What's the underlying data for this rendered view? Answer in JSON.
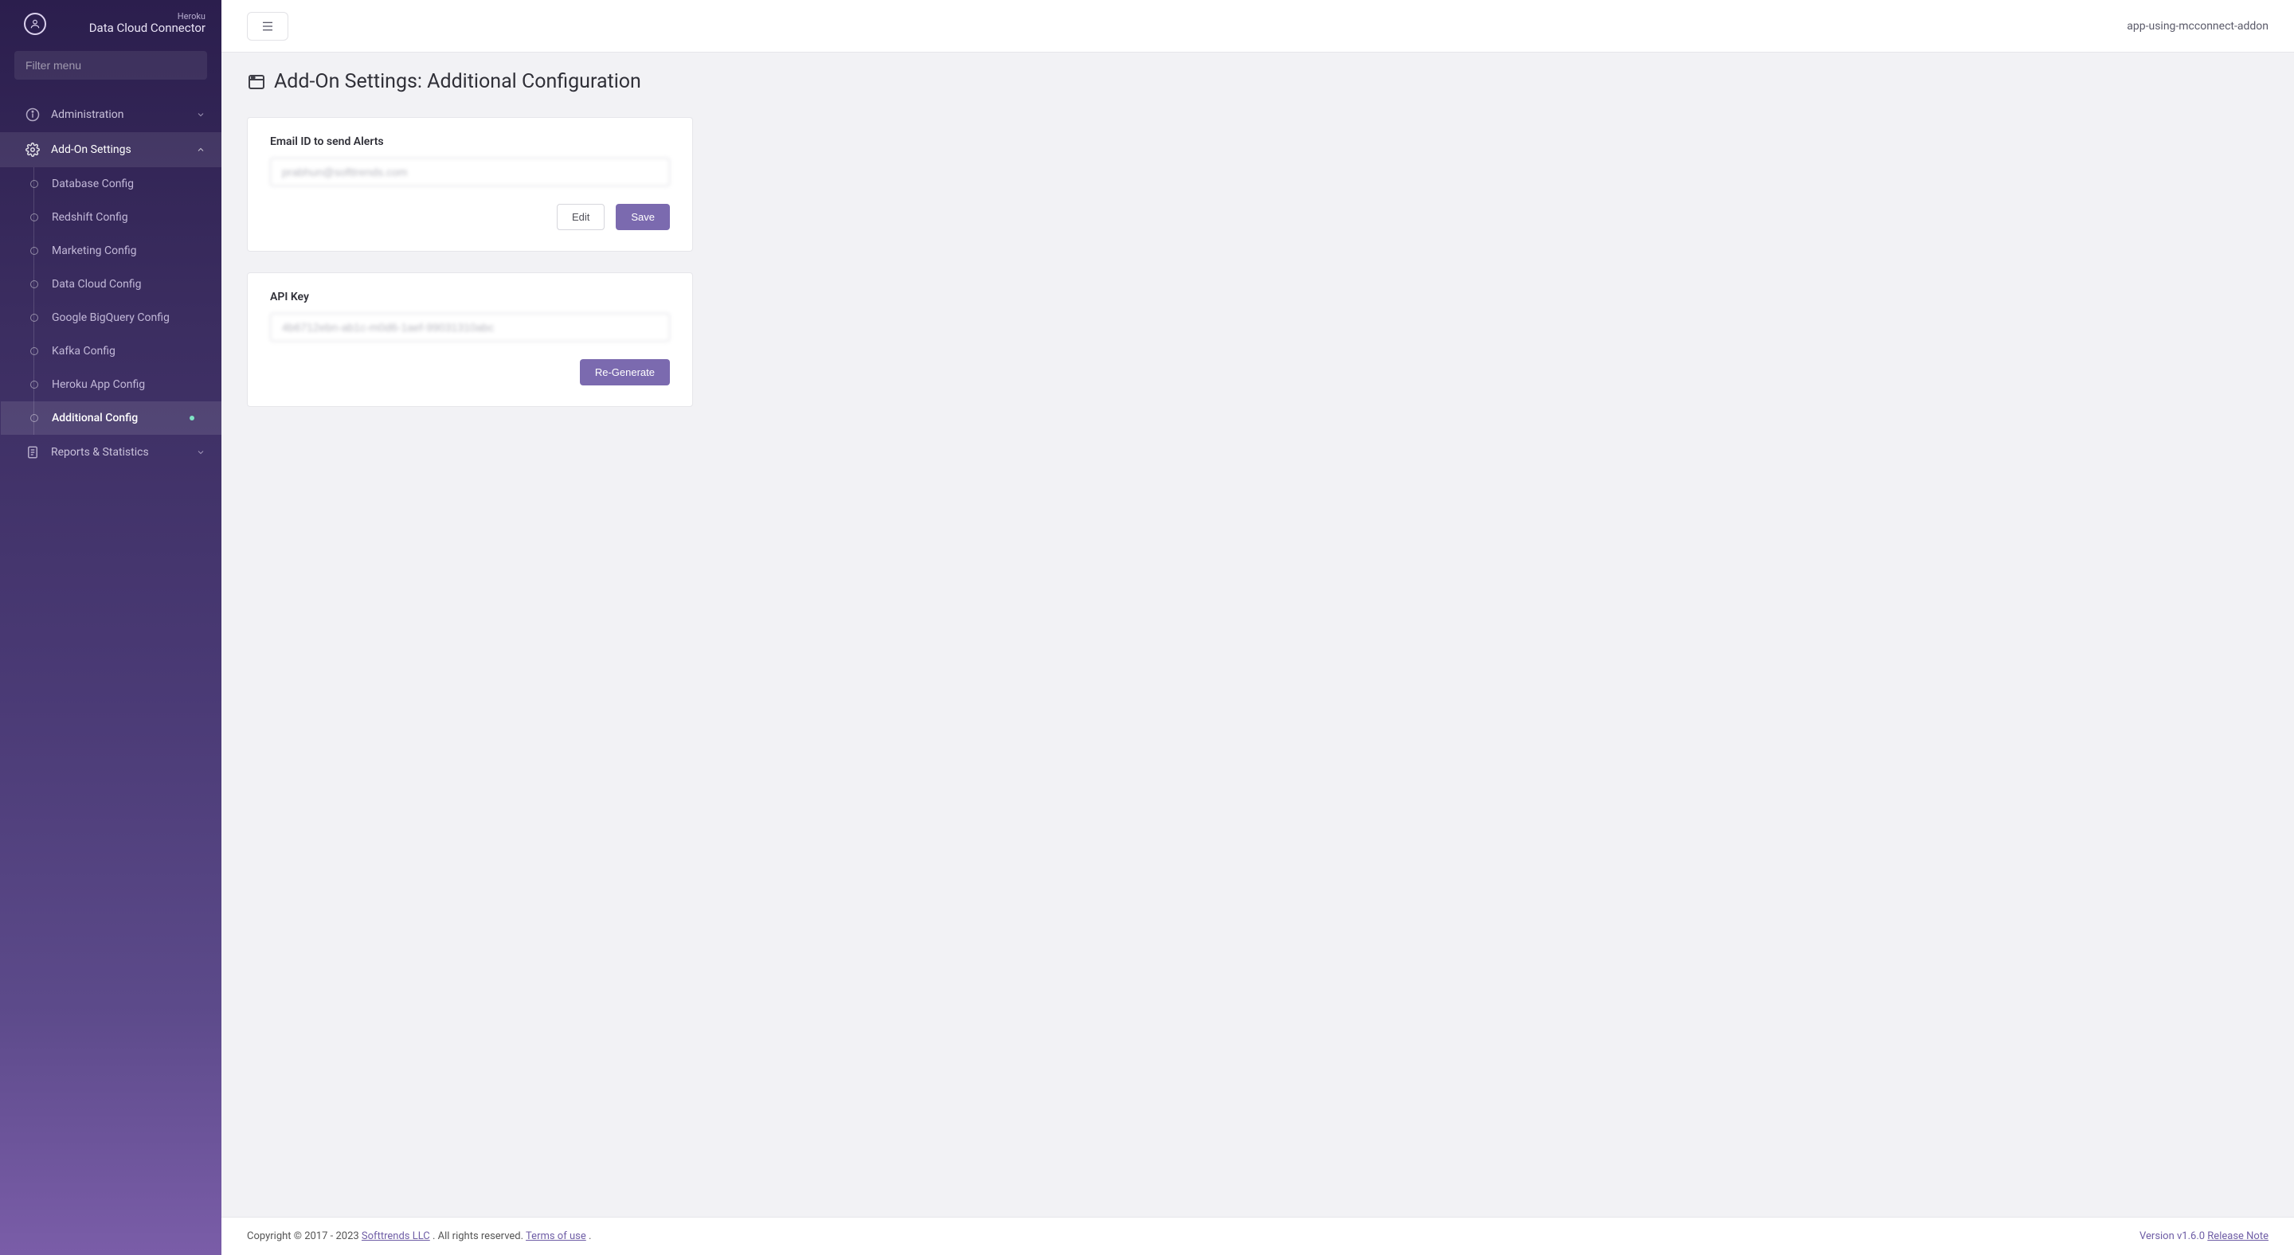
{
  "brand": {
    "top": "Heroku",
    "bottom": "Data Cloud Connector"
  },
  "sidebar": {
    "filter_placeholder": "Filter menu",
    "sections": [
      {
        "icon": "info",
        "label": "Administration",
        "expanded": false
      },
      {
        "icon": "gear",
        "label": "Add-On Settings",
        "expanded": true
      },
      {
        "icon": "file",
        "label": "Reports & Statistics",
        "expanded": false
      }
    ],
    "addon_items": [
      {
        "label": "Database Config"
      },
      {
        "label": "Redshift Config"
      },
      {
        "label": "Marketing Config"
      },
      {
        "label": "Data Cloud Config"
      },
      {
        "label": "Google BigQuery Config"
      },
      {
        "label": "Kafka Config"
      },
      {
        "label": "Heroku App Config"
      },
      {
        "label": "Additional Config",
        "active": true
      }
    ]
  },
  "topbar": {
    "app_name": "app-using-mcconnect-addon"
  },
  "page": {
    "title": "Add-On Settings: Additional Configuration"
  },
  "email_card": {
    "label": "Email ID to send Alerts",
    "value": "prabhun@softtrends.com",
    "edit": "Edit",
    "save": "Save"
  },
  "api_card": {
    "label": "API Key",
    "value": "4b6712ebn-ab1c-m0d6-1aef-99031310abc",
    "regenerate": "Re-Generate"
  },
  "footer": {
    "copyright_prefix": "Copyright © 2017 - 2023 ",
    "company": "Softtrends LLC",
    "rights": ". All rights reserved.",
    "terms": "Terms of use",
    "dot": ".",
    "version": "Version v1.6.0 ",
    "release": " Release Note"
  }
}
